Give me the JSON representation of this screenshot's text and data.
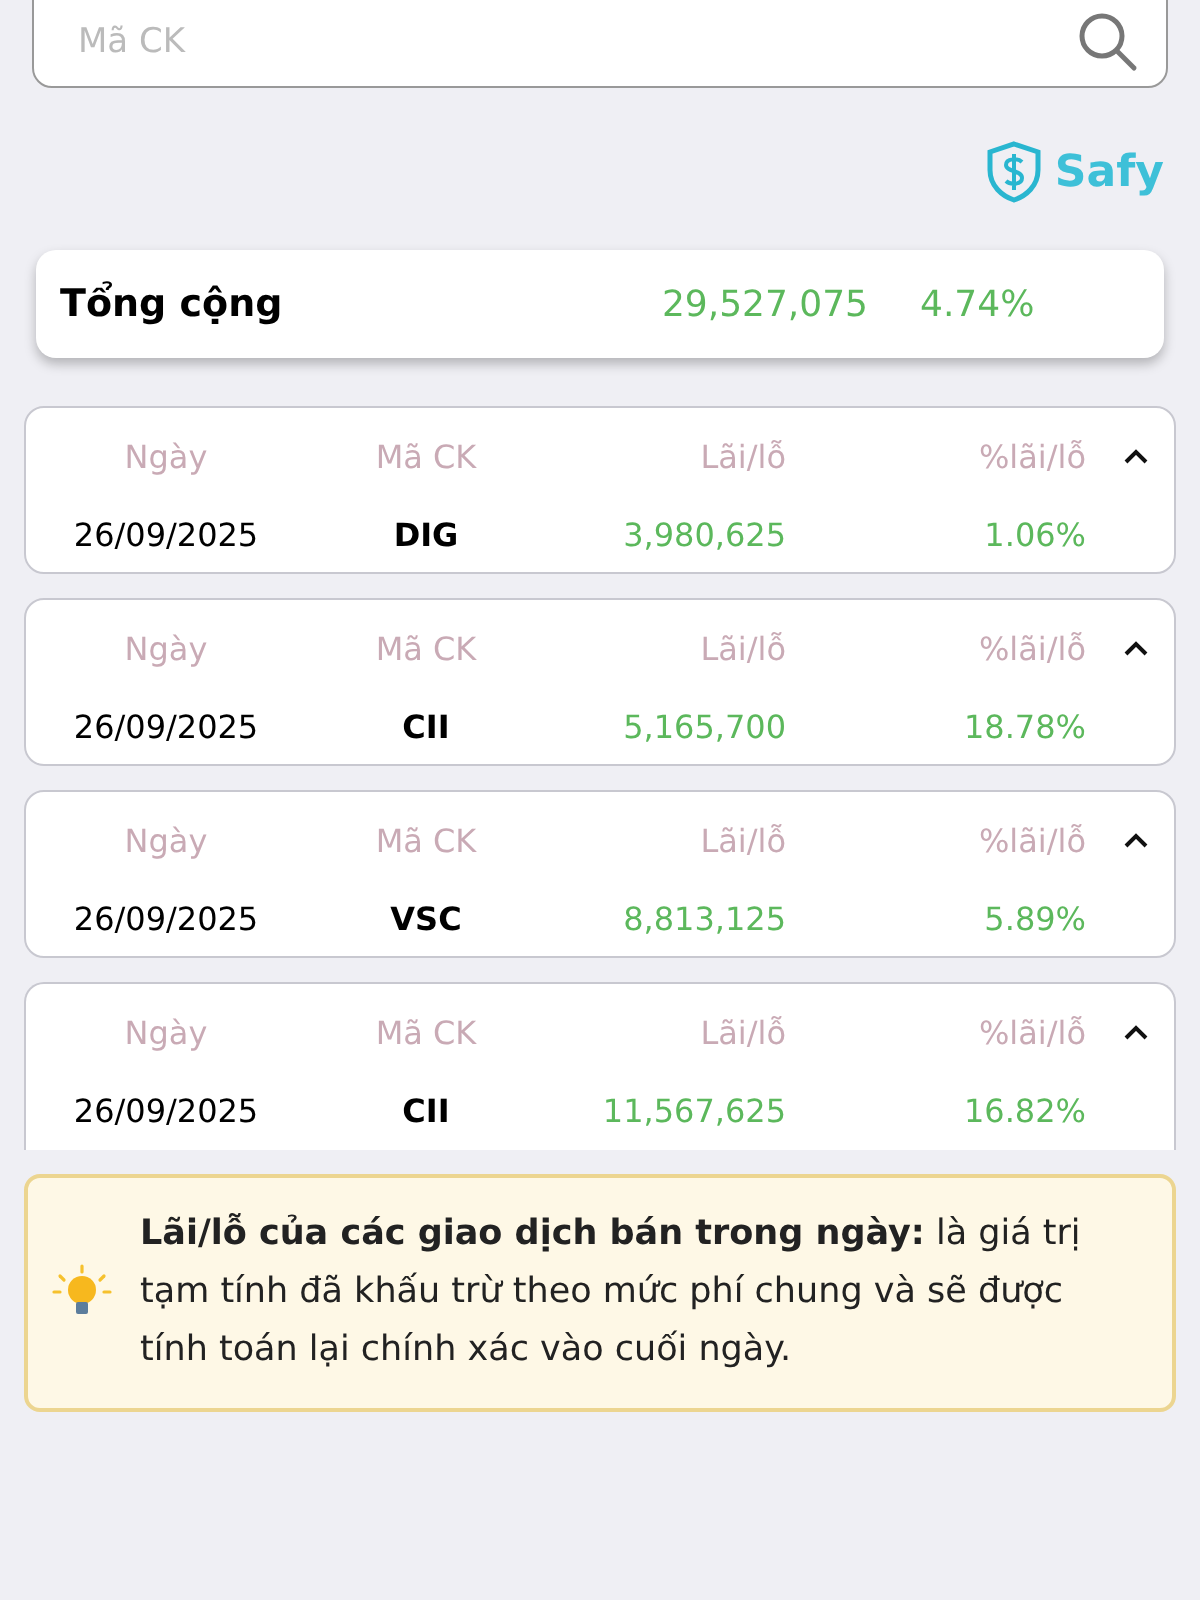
{
  "search": {
    "placeholder": "Mã CK"
  },
  "brand": {
    "name": "Safy"
  },
  "total": {
    "label": "Tổng cộng",
    "amount": "29,527,075",
    "percent": "4.74%"
  },
  "trades": [
    {
      "headers": [
        "Ngày",
        "Mã CK",
        "Lãi/lỗ",
        "%lãi/lỗ"
      ],
      "date": "26/09/2025",
      "code": "DIG",
      "pnl": "3,980,625",
      "pnl_percent": "1.06%",
      "expanded": true
    },
    {
      "headers": [
        "Ngày",
        "Mã CK",
        "Lãi/lỗ",
        "%lãi/lỗ"
      ],
      "date": "26/09/2025",
      "code": "CII",
      "pnl": "5,165,700",
      "pnl_percent": "18.78%",
      "expanded": true
    },
    {
      "headers": [
        "Ngày",
        "Mã CK",
        "Lãi/lỗ",
        "%lãi/lỗ"
      ],
      "date": "26/09/2025",
      "code": "VSC",
      "pnl": "8,813,125",
      "pnl_percent": "5.89%",
      "expanded": true
    },
    {
      "headers": [
        "Ngày",
        "Mã CK",
        "Lãi/lỗ",
        "%lãi/lỗ"
      ],
      "date": "26/09/2025",
      "code": "CII",
      "pnl": "11,567,625",
      "pnl_percent": "16.82%",
      "expanded": true
    }
  ],
  "notice": {
    "text": "**Lãi/lỗ của các giao dịch bán trong ngày:** là giá trị tạm tính đã khấu trừ theo mức phí chung và sẽ được tính toán lại chính xác vào cuối ngày."
  }
}
